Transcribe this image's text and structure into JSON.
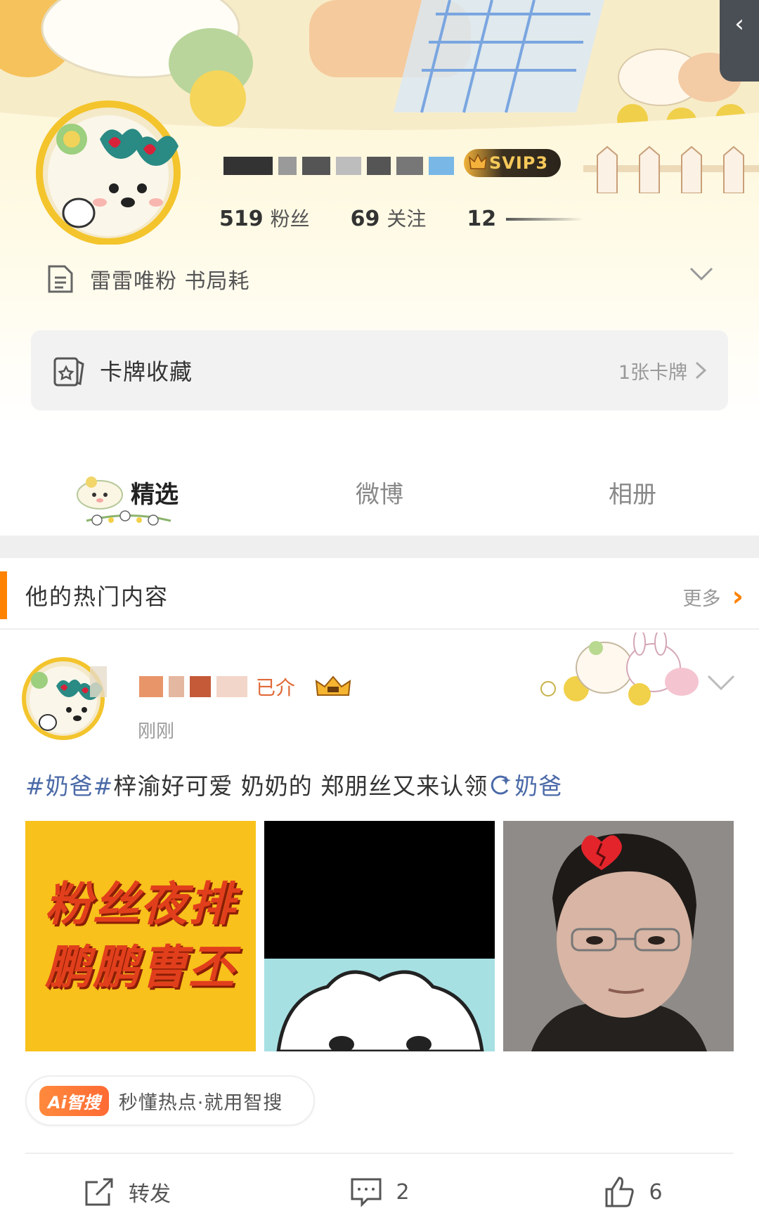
{
  "nav": {
    "back_icon": "chevron-left-icon"
  },
  "profile": {
    "vip_badge": "SVIP3",
    "stats": [
      {
        "num": "519",
        "label": "粉丝"
      },
      {
        "num": "69",
        "label": "关注"
      },
      {
        "num": "12",
        "label": ""
      }
    ],
    "bio": "雷雷唯粉 书局耗",
    "bio_icon": "document-icon",
    "cards": {
      "title": "卡牌收藏",
      "count": "1张卡牌"
    }
  },
  "tabs": [
    {
      "label": "精选",
      "active": true
    },
    {
      "label": "微博",
      "active": false
    },
    {
      "label": "相册",
      "active": false
    }
  ],
  "hot": {
    "title": "他的热门内容",
    "more": "更多",
    "accent": "#ff8200"
  },
  "post": {
    "name_tail": "已介",
    "time": "刚刚",
    "text": {
      "tag1": "#奶爸#",
      "body": "梓渝好可爱 奶奶的 郑朋丝又来认领",
      "link": "奶爸"
    },
    "images": {
      "img1_line1": "粉丝夜排",
      "img1_line2": "鹏鹏曹丕"
    },
    "ai": {
      "badge": "Ai智搜",
      "text": "秒懂热点·就用智搜"
    },
    "actions": {
      "repost": "转发",
      "comments": "2",
      "likes": "6"
    }
  },
  "colors": {
    "link": "#4b6aa8",
    "accent": "#ff8200"
  }
}
